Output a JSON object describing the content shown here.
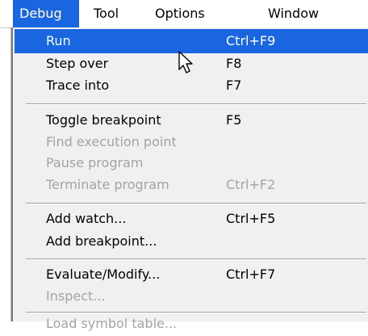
{
  "menubar": {
    "items": [
      {
        "label": "Debug",
        "active": true
      },
      {
        "label": "Tool"
      },
      {
        "label": "Options"
      },
      {
        "label": "Window"
      }
    ]
  },
  "debug_menu": {
    "items": [
      {
        "label": "Run",
        "shortcut": "Ctrl+F9",
        "state": "highlighted"
      },
      {
        "label": "Step over",
        "shortcut": "F8",
        "state": "enabled"
      },
      {
        "label": "Trace into",
        "shortcut": "F7",
        "state": "enabled"
      },
      {
        "label": "Toggle breakpoint",
        "shortcut": "F5",
        "state": "enabled"
      },
      {
        "label": "Find execution point",
        "shortcut": "",
        "state": "disabled"
      },
      {
        "label": "Pause program",
        "shortcut": "",
        "state": "disabled"
      },
      {
        "label": "Terminate program",
        "shortcut": "Ctrl+F2",
        "state": "disabled"
      },
      {
        "label": "Add watch...",
        "shortcut": "Ctrl+F5",
        "state": "enabled"
      },
      {
        "label": "Add breakpoint...",
        "shortcut": "",
        "state": "enabled"
      },
      {
        "label": "Evaluate/Modify...",
        "shortcut": "Ctrl+F7",
        "state": "enabled"
      },
      {
        "label": "Inspect...",
        "shortcut": "",
        "state": "disabled"
      },
      {
        "label": "Load symbol table...",
        "shortcut": "",
        "state": "disabled"
      }
    ]
  },
  "colors": {
    "highlight": "#1a66e0",
    "menu_background": "#f0f0f0",
    "disabled_text": "#a3a3a3"
  },
  "icons": {
    "cursor": "mouse-pointer-icon"
  }
}
